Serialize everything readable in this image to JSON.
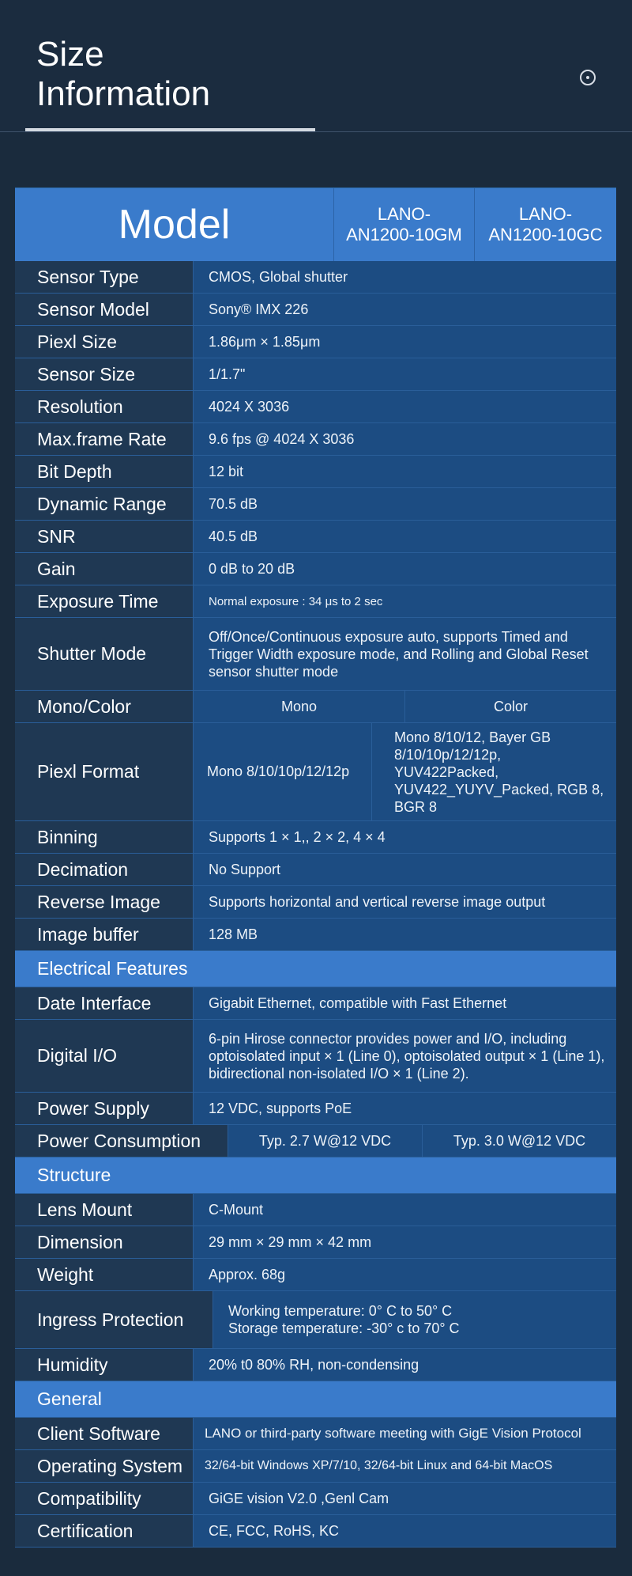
{
  "header": {
    "title": "Size\nInformation"
  },
  "model": {
    "label": "Model",
    "variants": [
      "LANO-\nAN1200-10GM",
      "LANO-\nAN1200-10GC"
    ]
  },
  "specs": [
    {
      "label": "Sensor Type",
      "value": "CMOS, Global shutter"
    },
    {
      "label": "Sensor Model",
      "value": "Sony® IMX 226"
    },
    {
      "label": "Piexl Size",
      "value": "1.86μm × 1.85μm"
    },
    {
      "label": "Sensor Size",
      "value": "1/1.7\""
    },
    {
      "label": "Resolution",
      "value": "4024 X 3036"
    },
    {
      "label": "Max.frame Rate",
      "value": "9.6 fps @ 4024 X 3036"
    },
    {
      "label": "Bit Depth",
      "value": "12 bit"
    },
    {
      "label": "Dynamic Range",
      "value": "70.5 dB"
    },
    {
      "label": "SNR",
      "value": "40.5 dB"
    },
    {
      "label": "Gain",
      "value": "0 dB to 20 dB"
    },
    {
      "label": "Exposure Time",
      "value": "Normal exposure : 34 μs to 2 sec"
    },
    {
      "label": "Shutter Mode",
      "value": "Off/Once/Continuous exposure auto, supports Timed and Trigger Width exposure mode, and Rolling and Global Reset sensor shutter mode"
    },
    {
      "label": "Mono/Color",
      "mono": "Mono",
      "color": "Color"
    },
    {
      "label": "Piexl Format",
      "mono": "Mono 8/10/10p/12/12p",
      "color": "Mono 8/10/12, Bayer GB 8/10/10p/12/12p, YUV422Packed, YUV422_YUYV_Packed, RGB 8, BGR 8"
    },
    {
      "label": "Binning",
      "value": "Supports 1 × 1,, 2 × 2, 4 × 4"
    },
    {
      "label": "Decimation",
      "value": "No Support"
    },
    {
      "label": "Reverse Image",
      "value": "Supports horizontal and vertical reverse image output"
    },
    {
      "label": "Image buffer",
      "value": "128 MB"
    }
  ],
  "electrical": {
    "title": "Electrical Features",
    "rows": [
      {
        "label": "Date Interface",
        "value": "Gigabit Ethernet, compatible with Fast Ethernet"
      },
      {
        "label": "Digital I/O",
        "value": "6-pin Hirose connector provides power and I/O, including optoisolated input × 1 (Line 0), optoisolated output × 1 (Line 1), bidirectional non-isolated I/O × 1 (Line 2)."
      },
      {
        "label": "Power Supply",
        "value": "12 VDC, supports PoE"
      },
      {
        "label": "Power Consumption",
        "mono": "Typ. 2.7 W@12 VDC",
        "color": "Typ. 3.0 W@12 VDC"
      }
    ]
  },
  "structure": {
    "title": "Structure",
    "rows": [
      {
        "label": "Lens Mount",
        "value": "C-Mount"
      },
      {
        "label": "Dimension",
        "value": "29 mm × 29 mm × 42 mm"
      },
      {
        "label": "Weight",
        "value": "Approx. 68g"
      },
      {
        "label": "Ingress Protection",
        "value": "Working temperature:  0° C to  50° C\nStorage temperature: -30° c to 70° C"
      },
      {
        "label": "Humidity",
        "value": "20% t0  80% RH, non-condensing"
      }
    ]
  },
  "general": {
    "title": "General",
    "rows": [
      {
        "label": "Client Software",
        "value": "LANO or third-party software meeting with GigE Vision Protocol"
      },
      {
        "label": "Operating System",
        "value": "32/64-bit Windows XP/7/10, 32/64-bit Linux and 64-bit MacOS"
      },
      {
        "label": "Compatibility",
        "value": "GiGE vision V2.0 ,Genl Cam"
      },
      {
        "label": "Certification",
        "value": "CE, FCC, RoHS, KC"
      }
    ]
  }
}
